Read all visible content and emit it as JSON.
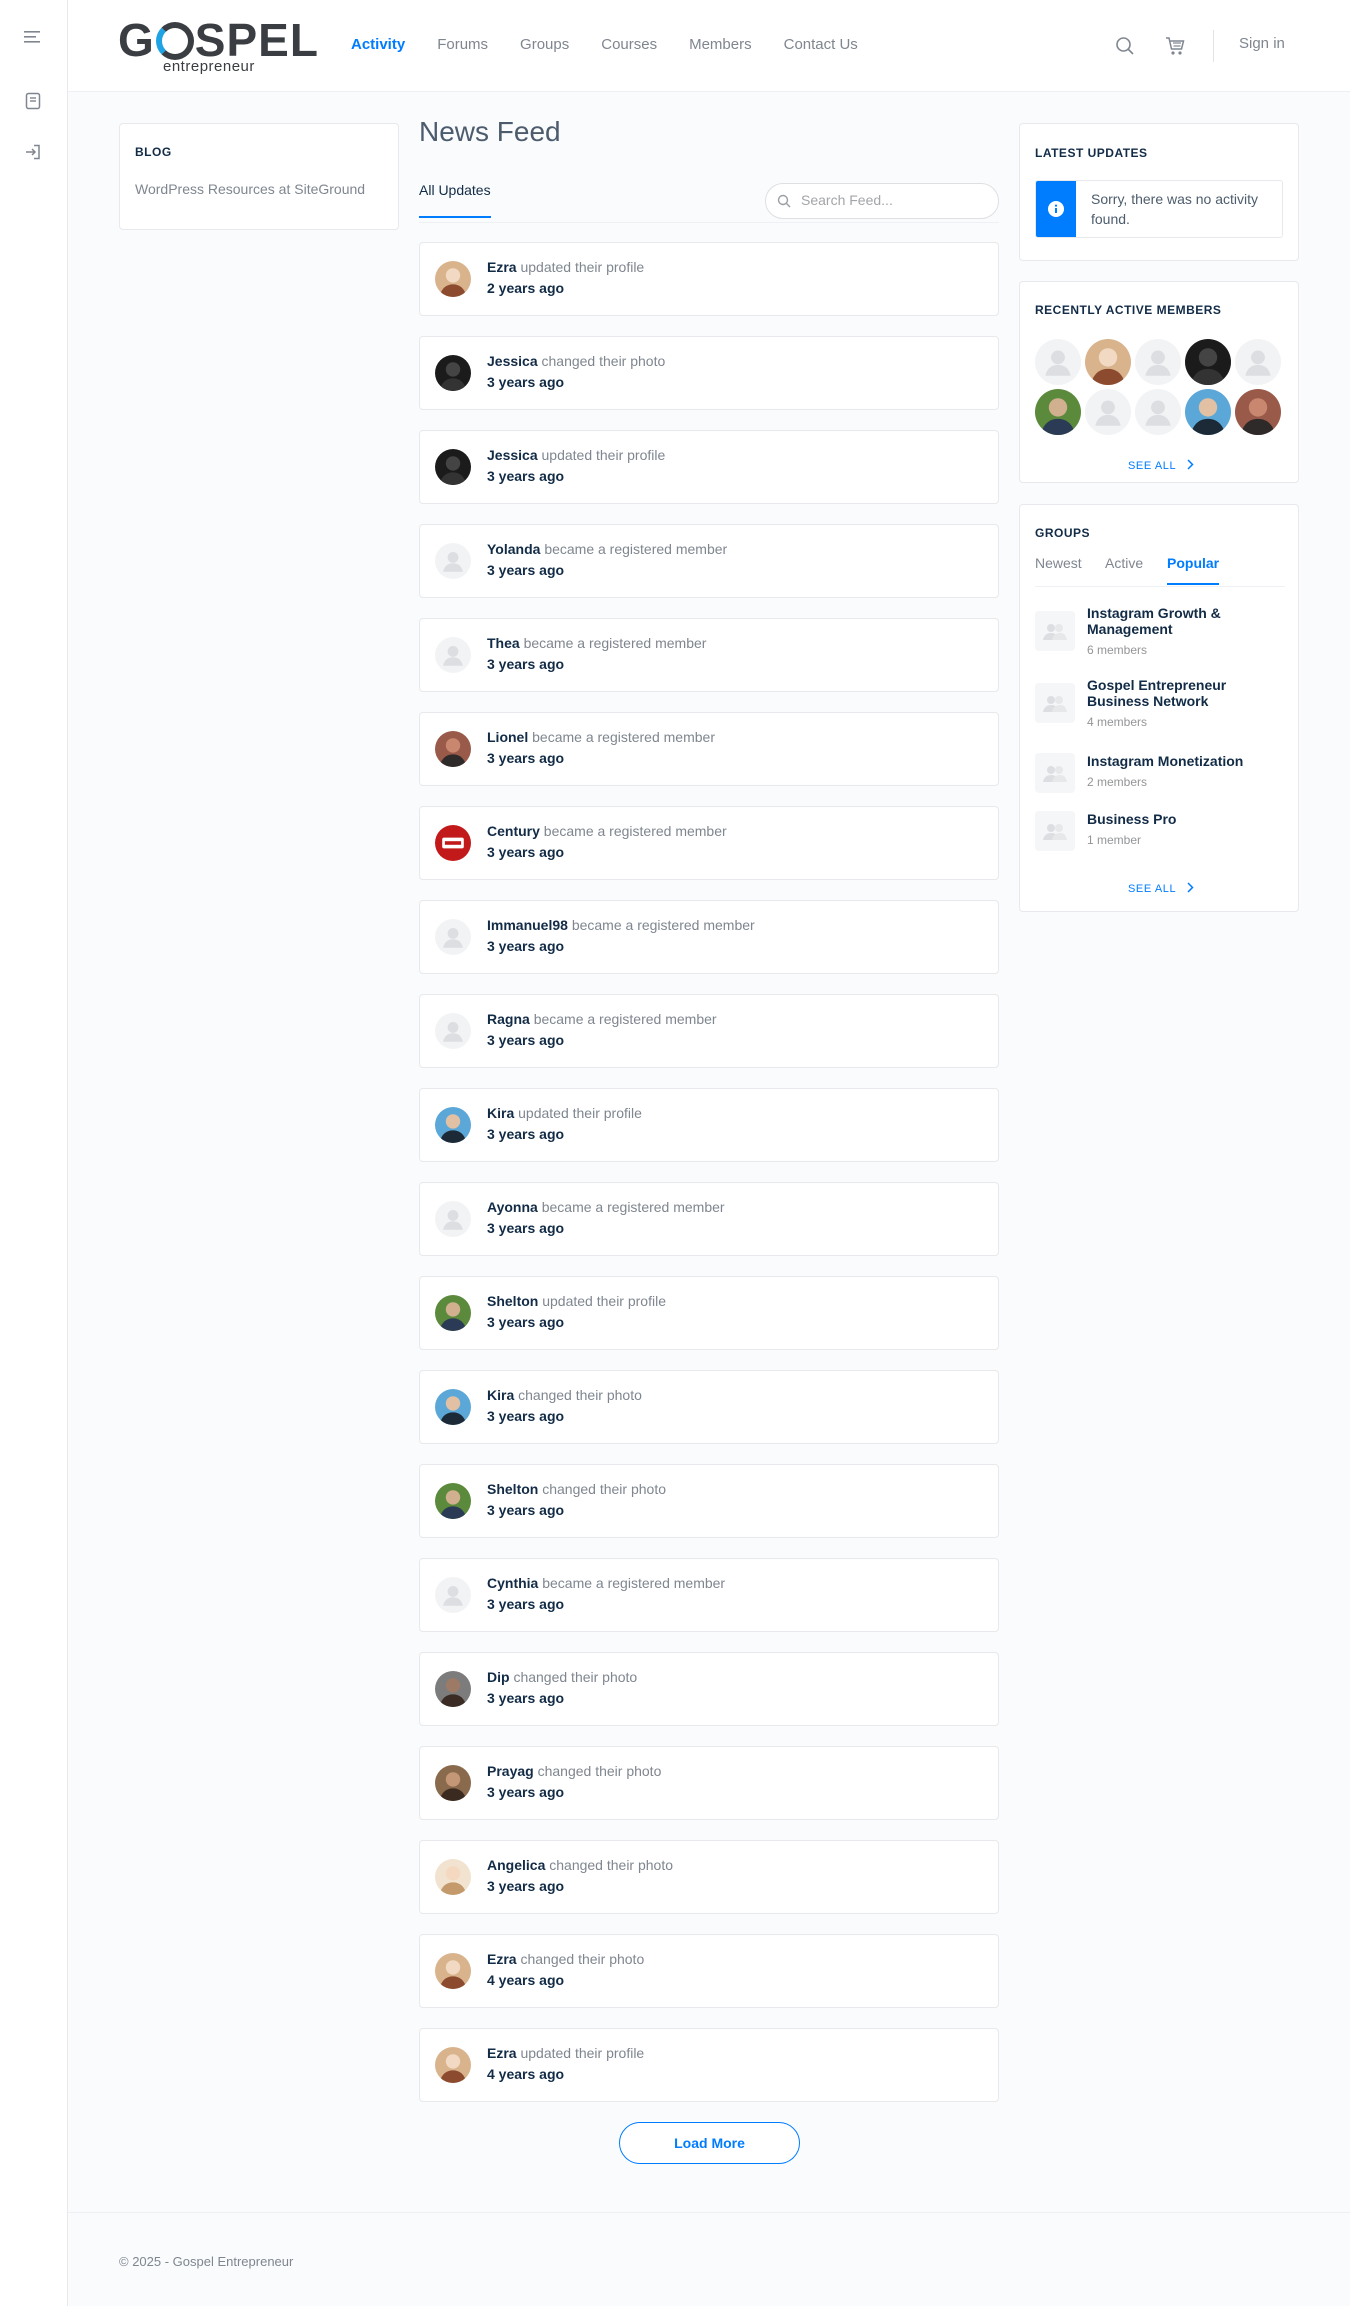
{
  "brand": {
    "name_prefix": "G",
    "name_rest": "SPEL",
    "subtitle": "entrepreneur",
    "accent": "#1fa3e5",
    "primary": "#007cff"
  },
  "nav": {
    "items": [
      "Activity",
      "Forums",
      "Groups",
      "Courses",
      "Members",
      "Contact Us"
    ],
    "active": "Activity"
  },
  "header": {
    "signin": "Sign in"
  },
  "rail": {
    "icons": [
      "menu-icon",
      "book-icon",
      "login-icon"
    ]
  },
  "blog": {
    "title": "BLOG",
    "link": "WordPress Resources at SiteGround"
  },
  "feed": {
    "title": "News Feed",
    "tab": "All Updates",
    "search_placeholder": "Search Feed...",
    "items": [
      {
        "user": "Ezra",
        "action": "updated their profile",
        "time": "2 years ago",
        "avatar": "photo-ezra"
      },
      {
        "user": "Jessica",
        "action": "changed their photo",
        "time": "3 years ago",
        "avatar": "photo-dark"
      },
      {
        "user": "Jessica",
        "action": "updated their profile",
        "time": "3 years ago",
        "avatar": "photo-dark"
      },
      {
        "user": "Yolanda",
        "action": "became a registered member",
        "time": "3 years ago",
        "avatar": "placeholder"
      },
      {
        "user": "Thea",
        "action": "became a registered member",
        "time": "3 years ago",
        "avatar": "placeholder"
      },
      {
        "user": "Lionel",
        "action": "became a registered member",
        "time": "3 years ago",
        "avatar": "photo-lionel"
      },
      {
        "user": "Century",
        "action": "became a registered member",
        "time": "3 years ago",
        "avatar": "logo-century"
      },
      {
        "user": "Immanuel98",
        "action": "became a registered member",
        "time": "3 years ago",
        "avatar": "placeholder"
      },
      {
        "user": "Ragna",
        "action": "became a registered member",
        "time": "3 years ago",
        "avatar": "placeholder"
      },
      {
        "user": "Kira",
        "action": "updated their profile",
        "time": "3 years ago",
        "avatar": "photo-kira"
      },
      {
        "user": "Ayonna",
        "action": "became a registered member",
        "time": "3 years ago",
        "avatar": "placeholder"
      },
      {
        "user": "Shelton",
        "action": "updated their profile",
        "time": "3 years ago",
        "avatar": "photo-shelton"
      },
      {
        "user": "Kira",
        "action": "changed their photo",
        "time": "3 years ago",
        "avatar": "photo-kira"
      },
      {
        "user": "Shelton",
        "action": "changed their photo",
        "time": "3 years ago",
        "avatar": "photo-shelton"
      },
      {
        "user": "Cynthia",
        "action": "became a registered member",
        "time": "3 years ago",
        "avatar": "placeholder"
      },
      {
        "user": "Dip",
        "action": "changed their photo",
        "time": "3 years ago",
        "avatar": "photo-dip"
      },
      {
        "user": "Prayag",
        "action": "changed their photo",
        "time": "3 years ago",
        "avatar": "photo-prayag"
      },
      {
        "user": "Angelica",
        "action": "changed their photo",
        "time": "3 years ago",
        "avatar": "photo-angelica"
      },
      {
        "user": "Ezra",
        "action": "changed their photo",
        "time": "4 years ago",
        "avatar": "photo-ezra"
      },
      {
        "user": "Ezra",
        "action": "updated their profile",
        "time": "4 years ago",
        "avatar": "photo-ezra"
      }
    ],
    "load_more": "Load More"
  },
  "latest_updates": {
    "title": "LATEST UPDATES",
    "notice": "Sorry, there was no activity found."
  },
  "recently_active": {
    "title": "RECENTLY ACTIVE MEMBERS",
    "avatars": [
      "placeholder",
      "photo-ezra",
      "placeholder",
      "photo-dark",
      "placeholder",
      "photo-shelton",
      "placeholder",
      "placeholder",
      "photo-kira",
      "photo-lionel"
    ],
    "see_all": "SEE ALL"
  },
  "groups": {
    "title": "GROUPS",
    "tabs": [
      "Newest",
      "Active",
      "Popular"
    ],
    "active_tab": "Popular",
    "items": [
      {
        "name": "Instagram Growth & Management",
        "meta": "6 members"
      },
      {
        "name": "Gospel Entrepreneur Business Network",
        "meta": "4 members"
      },
      {
        "name": "Instagram Monetization",
        "meta": "2 members"
      },
      {
        "name": "Business Pro",
        "meta": "1 member"
      }
    ],
    "see_all": "SEE ALL"
  },
  "footer": {
    "text": "© 2025 - Gospel Entrepreneur"
  }
}
